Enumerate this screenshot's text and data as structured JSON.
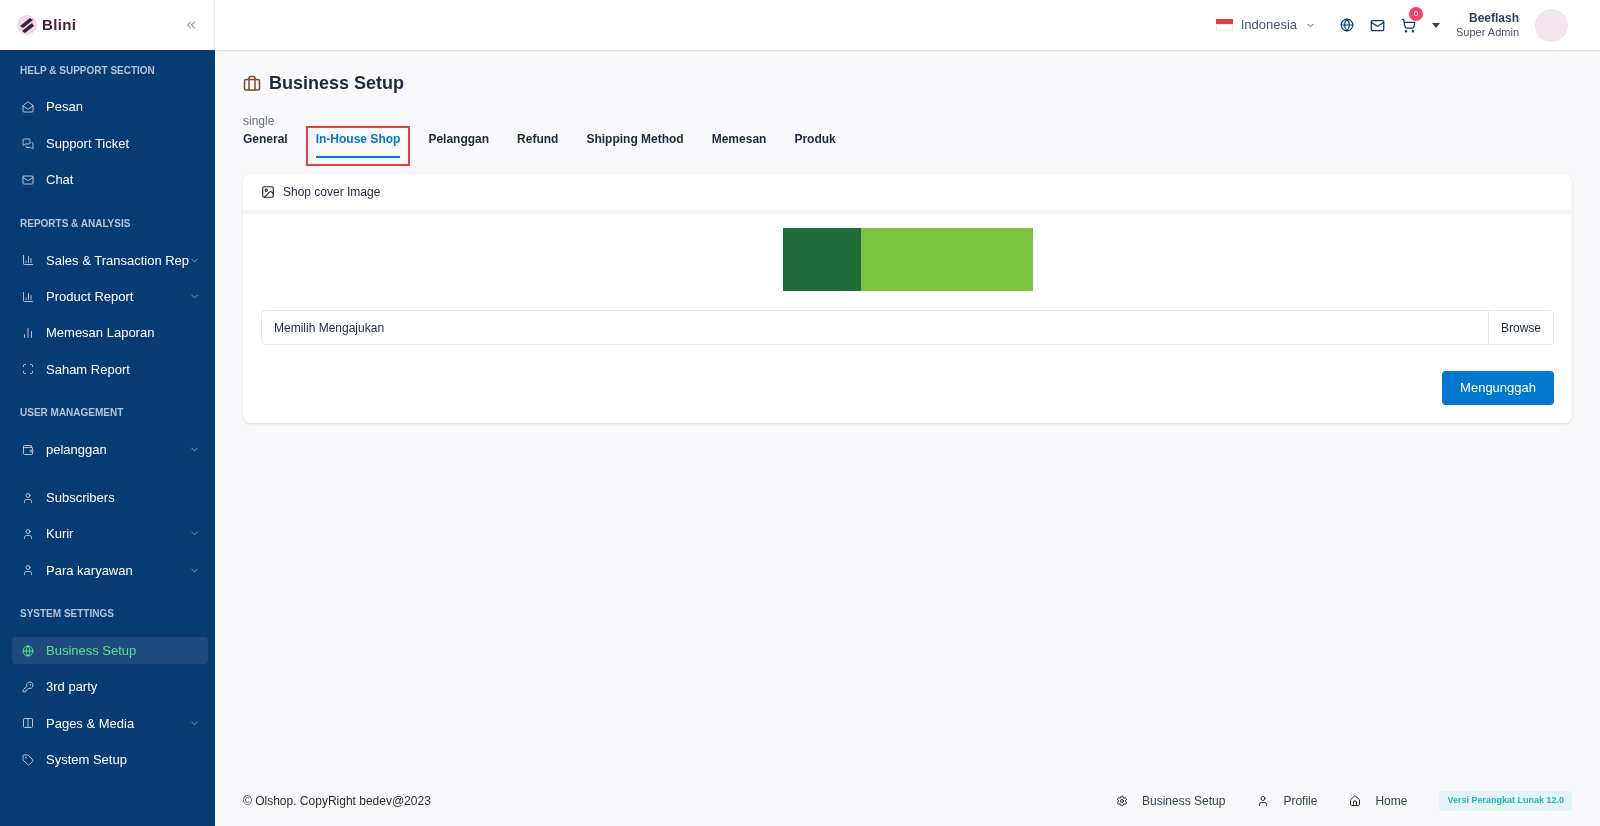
{
  "brand": {
    "name": "Blini"
  },
  "sidebar": {
    "sections": [
      {
        "title": "HELP & SUPPORT SECTION",
        "items": [
          {
            "label": "Pesan",
            "selected": false,
            "expandable": false
          },
          {
            "label": "Support Ticket",
            "selected": false,
            "expandable": false
          },
          {
            "label": "Chat",
            "selected": false,
            "expandable": false
          }
        ]
      },
      {
        "title": "REPORTS & ANALYSIS",
        "items": [
          {
            "label": "Sales & Transaction Rep",
            "selected": false,
            "expandable": true
          },
          {
            "label": "Product Report",
            "selected": false,
            "expandable": true
          },
          {
            "label": "Memesan Laporan",
            "selected": false,
            "expandable": false
          },
          {
            "label": "Saham Report",
            "selected": false,
            "expandable": false
          }
        ]
      },
      {
        "title": "USER MANAGEMENT",
        "items": [
          {
            "label": "pelanggan",
            "selected": false,
            "expandable": true
          },
          {
            "label": "Subscribers",
            "selected": false,
            "expandable": false
          },
          {
            "label": "Kurir",
            "selected": false,
            "expandable": true
          },
          {
            "label": "Para karyawan",
            "selected": false,
            "expandable": true
          }
        ]
      },
      {
        "title": "SYSTEM SETTINGS",
        "items": [
          {
            "label": "Business Setup",
            "selected": true,
            "expandable": false
          },
          {
            "label": "3rd party",
            "selected": false,
            "expandable": false
          },
          {
            "label": "Pages & Media",
            "selected": false,
            "expandable": true
          },
          {
            "label": "System Setup",
            "selected": false,
            "expandable": false
          }
        ]
      }
    ]
  },
  "header": {
    "language": "Indonesia",
    "cart_count": "0",
    "user_name": "Beeflash",
    "user_role": "Super Admin"
  },
  "page": {
    "title": "Business Setup",
    "tabs_caption": "single",
    "tabs": [
      {
        "label": "General",
        "selected": false,
        "outlined": false
      },
      {
        "label": "In-House Shop",
        "selected": true,
        "outlined": true
      },
      {
        "label": "Pelanggan",
        "selected": false,
        "outlined": false
      },
      {
        "label": "Refund",
        "selected": false,
        "outlined": false
      },
      {
        "label": "Shipping Method",
        "selected": false,
        "outlined": false
      },
      {
        "label": "Memesan",
        "selected": false,
        "outlined": false
      },
      {
        "label": "Produk",
        "selected": false,
        "outlined": false
      }
    ],
    "card": {
      "title": "Shop cover Image",
      "file_field": {
        "value": "Memilih Mengajukan",
        "button": "Browse"
      },
      "upload_button": "Mengunggah"
    }
  },
  "footer": {
    "copyright": "© Olshop. CopyRight bedev@2023",
    "links": [
      "Business Setup",
      "Profile",
      "Home"
    ],
    "version": "Versi Perangkat Lunak 12.0"
  }
}
